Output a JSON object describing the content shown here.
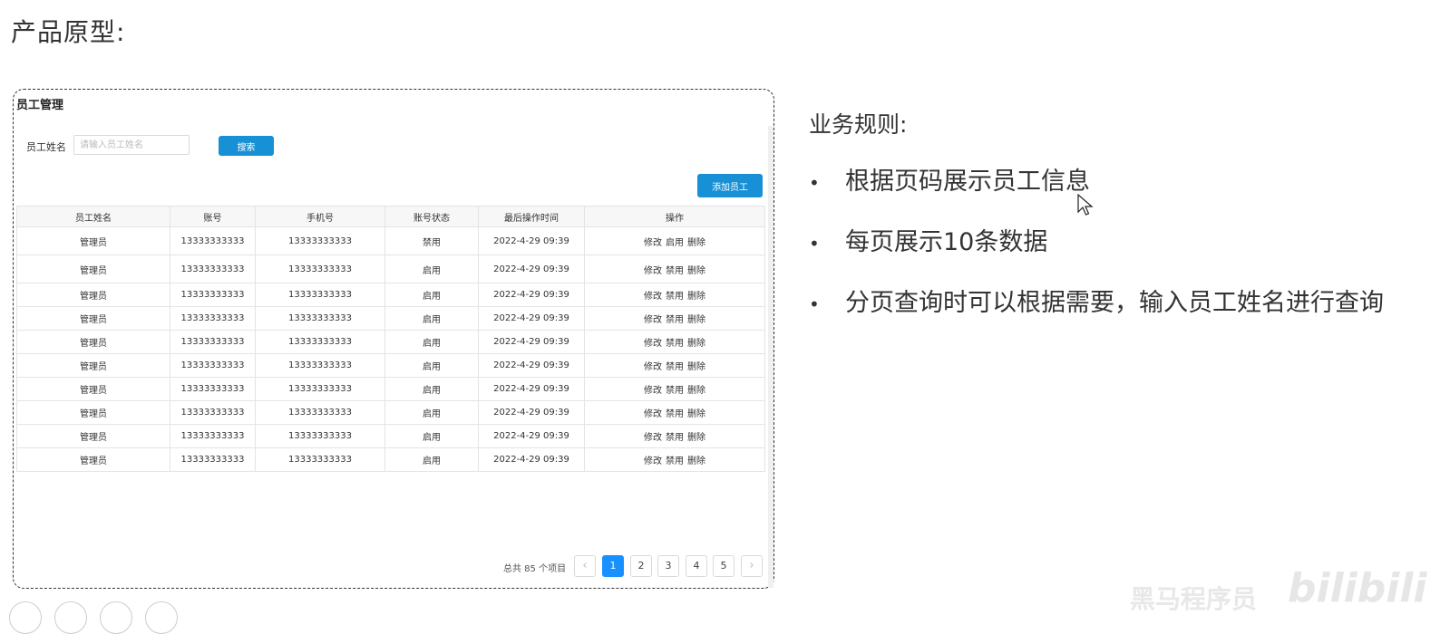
{
  "page": {
    "title": "产品原型:",
    "watermark": "黑马程序员",
    "watermark_logo": "bilibili"
  },
  "prototype": {
    "title": "员工管理",
    "search": {
      "label": "员工姓名",
      "placeholder": "请输入员工姓名",
      "button_label": "搜索"
    },
    "add_button_label": "添加员工",
    "table": {
      "columns": [
        "员工姓名",
        "账号",
        "手机号",
        "账号状态",
        "最后操作时间",
        "操作"
      ],
      "rows": [
        {
          "name": "管理员",
          "account": "13333333333",
          "phone": "13333333333",
          "status": "禁用",
          "time": "2022-4-29 09:39",
          "actions": [
            "修改",
            "启用",
            "删除"
          ]
        },
        {
          "name": "管理员",
          "account": "13333333333",
          "phone": "13333333333",
          "status": "启用",
          "time": "2022-4-29 09:39",
          "actions": [
            "修改",
            "禁用",
            "删除"
          ]
        },
        {
          "name": "管理员",
          "account": "13333333333",
          "phone": "13333333333",
          "status": "启用",
          "time": "2022-4-29 09:39",
          "actions": [
            "修改",
            "禁用",
            "删除"
          ]
        },
        {
          "name": "管理员",
          "account": "13333333333",
          "phone": "13333333333",
          "status": "启用",
          "time": "2022-4-29 09:39",
          "actions": [
            "修改",
            "禁用",
            "删除"
          ]
        },
        {
          "name": "管理员",
          "account": "13333333333",
          "phone": "13333333333",
          "status": "启用",
          "time": "2022-4-29 09:39",
          "actions": [
            "修改",
            "禁用",
            "删除"
          ]
        },
        {
          "name": "管理员",
          "account": "13333333333",
          "phone": "13333333333",
          "status": "启用",
          "time": "2022-4-29 09:39",
          "actions": [
            "修改",
            "禁用",
            "删除"
          ]
        },
        {
          "name": "管理员",
          "account": "13333333333",
          "phone": "13333333333",
          "status": "启用",
          "time": "2022-4-29 09:39",
          "actions": [
            "修改",
            "禁用",
            "删除"
          ]
        },
        {
          "name": "管理员",
          "account": "13333333333",
          "phone": "13333333333",
          "status": "启用",
          "time": "2022-4-29 09:39",
          "actions": [
            "修改",
            "禁用",
            "删除"
          ]
        },
        {
          "name": "管理员",
          "account": "13333333333",
          "phone": "13333333333",
          "status": "启用",
          "time": "2022-4-29 09:39",
          "actions": [
            "修改",
            "禁用",
            "删除"
          ]
        },
        {
          "name": "管理员",
          "account": "13333333333",
          "phone": "13333333333",
          "status": "启用",
          "time": "2022-4-29 09:39",
          "actions": [
            "修改",
            "禁用",
            "删除"
          ]
        }
      ]
    },
    "pagination": {
      "total_text": "总共 85 个项目",
      "pages": [
        "1",
        "2",
        "3",
        "4",
        "5"
      ],
      "current": "1",
      "prev_icon": "chevron-left-icon",
      "next_icon": "chevron-right-icon"
    }
  },
  "rules": {
    "title": "业务规则:",
    "items": [
      "根据页码展示员工信息",
      "每页展示10条数据",
      "分页查询时可以根据需要，输入员工姓名进行查询"
    ]
  },
  "colors": {
    "primary_button": "#1890d5",
    "active_page": "#1890ff"
  }
}
